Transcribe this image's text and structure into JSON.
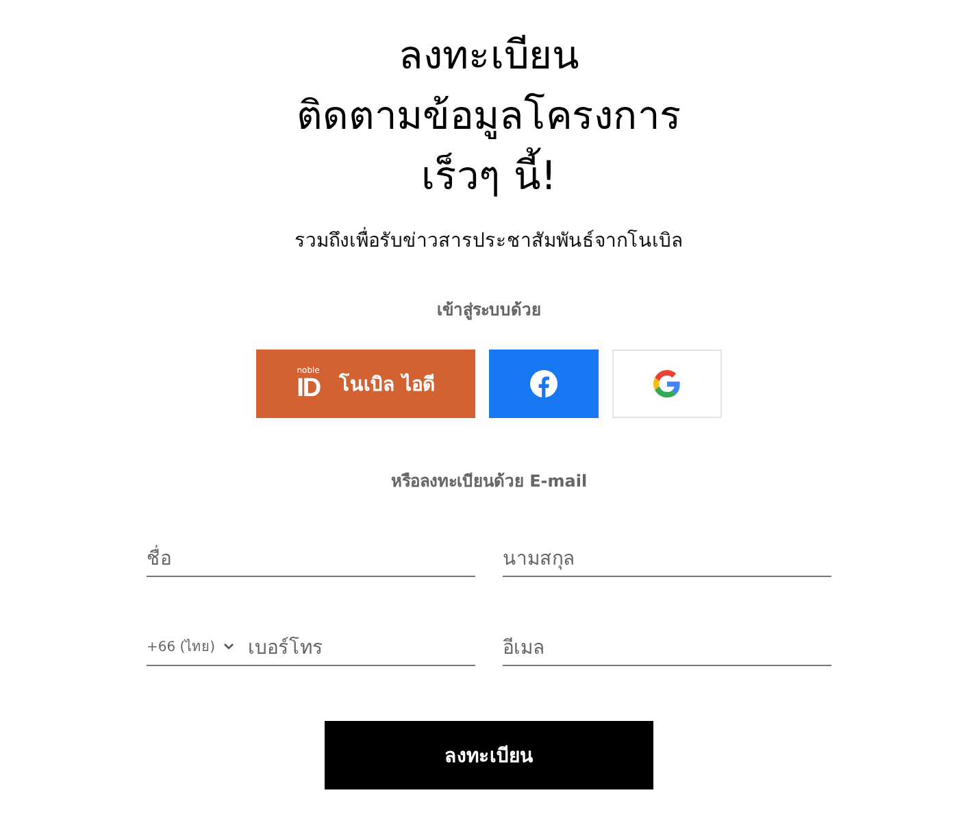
{
  "heading": [
    "ลงทะเบียน",
    "ติดตามข้อมูลโครงการ",
    "เร็วๆ นี้!"
  ],
  "subtitle": "รวมถึงเพื่อรับข่าวสารประชาสัมพันธ์จากโนเบิล",
  "login_label": "เข้าสู่ระบบด้วย",
  "login_buttons": [
    {
      "kind": "noble",
      "logo_small": "noble",
      "logo_main": "ID",
      "label": "โนเบิล ไอดี"
    },
    {
      "kind": "facebook"
    },
    {
      "kind": "google"
    }
  ],
  "email_label": "หรือลงทะเบียนด้วย E-mail",
  "fields": [
    {
      "kind": "text",
      "placeholder": "ชื่อ"
    },
    {
      "kind": "text",
      "placeholder": "นามสกุล"
    },
    {
      "kind": "phone",
      "country": "+66 (ไทย)",
      "placeholder": "เบอร์โทร"
    },
    {
      "kind": "text",
      "placeholder": "อีเมล"
    }
  ],
  "submit": "ลงทะเบียน"
}
